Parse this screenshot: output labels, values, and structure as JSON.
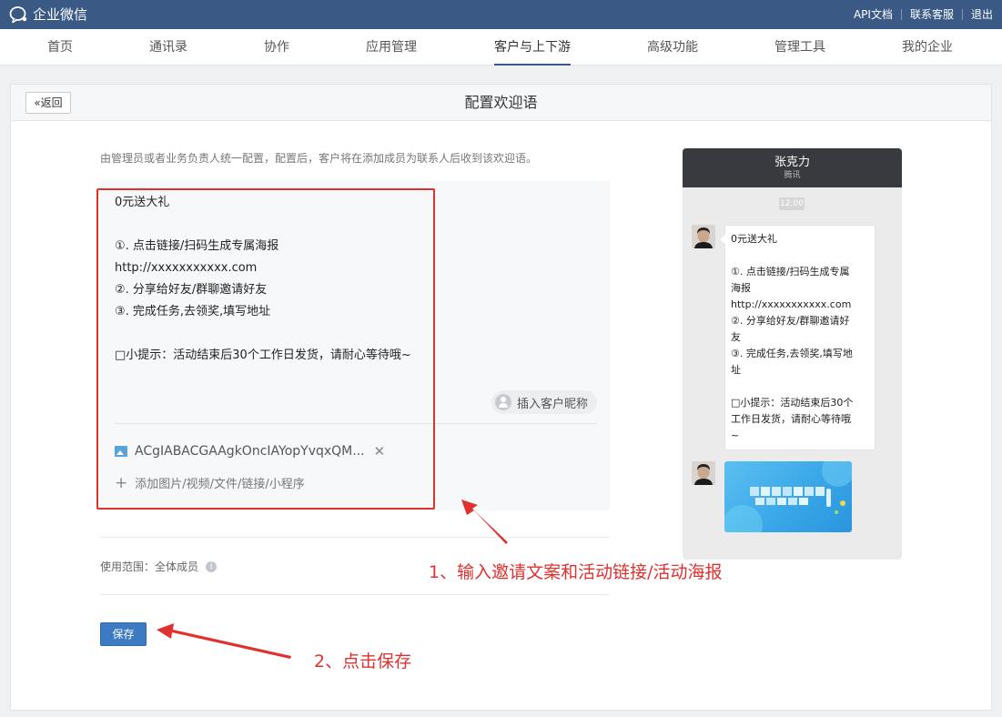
{
  "app": {
    "name": "企业微信",
    "links": [
      "API文档",
      "联系客服",
      "退出"
    ]
  },
  "nav": {
    "items": [
      "首页",
      "通讯录",
      "协作",
      "应用管理",
      "客户与上下游",
      "高级功能",
      "管理工具",
      "我的企业"
    ],
    "active": "客户与上下游"
  },
  "panel": {
    "back_label": "返回",
    "title": "配置欢迎语",
    "description": "由管理员或者业务负责人统一配置，配置后，客户将在添加成员为联系人后收到该欢迎语。"
  },
  "editor": {
    "lines": [
      "0元送大礼",
      "",
      "①. 点击链接/扫码生成专属海报",
      "http://xxxxxxxxxxx.com",
      "②. 分享给好友/群聊邀请好友",
      "③. 完成任务,去领奖,填写地址",
      "",
      "□小提示：活动结束后30个工作日发货，请耐心等待哦~"
    ],
    "insert_nickname_label": "插入客户昵称",
    "attachment_name": "ACgIABACGAAgkOncIAYopYvqxQM...",
    "add_media_label": "添加图片/视频/文件/链接/小程序"
  },
  "scope": {
    "label": "使用范围：全体成员"
  },
  "save_label": "保存",
  "annotations": {
    "step1": "1、输入邀请文案和活动链接/活动海报",
    "step2": "2、点击保存"
  },
  "preview": {
    "contact_name": "张克力",
    "contact_company": "腾讯",
    "time": "12:00",
    "bubble_lines": [
      "0元送大礼",
      "",
      "①. 点击链接/扫码生成专属",
      "海报",
      "http://xxxxxxxxxxx.com",
      "②. 分享给好友/群聊邀请好",
      "友",
      "③. 完成任务,去领奖,填写地",
      "址",
      "",
      "□小提示：活动结束后30个",
      "工作日发货，请耐心等待哦",
      "~"
    ]
  },
  "colors": {
    "topbar": "#3a5a85",
    "primary_button": "#3c7bc1",
    "annotation_red": "#e0312f"
  }
}
